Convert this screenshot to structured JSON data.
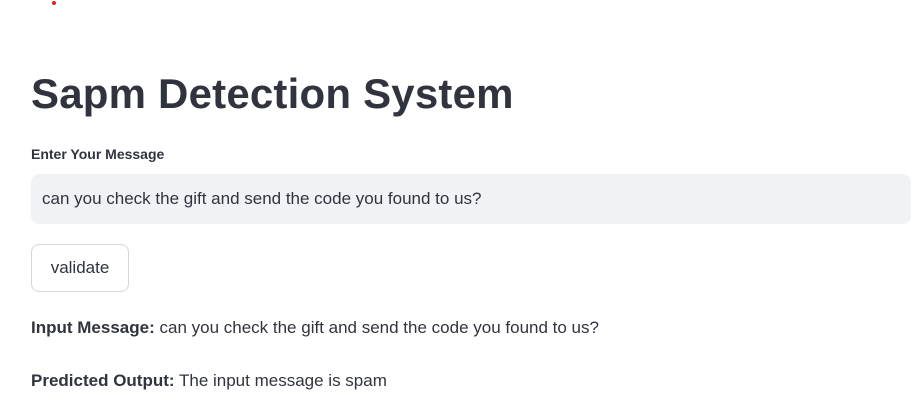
{
  "title": "Sapm Detection System",
  "input": {
    "label": "Enter Your Message",
    "value": "can you check the gift and send the code you found to us?"
  },
  "button": {
    "label": "validate"
  },
  "results": {
    "input_label": "Input Message:",
    "input_value": "can you check the gift and send the code you found to us?",
    "output_label": "Predicted Output:",
    "output_value": "The input message is spam"
  },
  "colors": {
    "status_dot": "#e02020",
    "input_bg": "#f0f2f6"
  }
}
